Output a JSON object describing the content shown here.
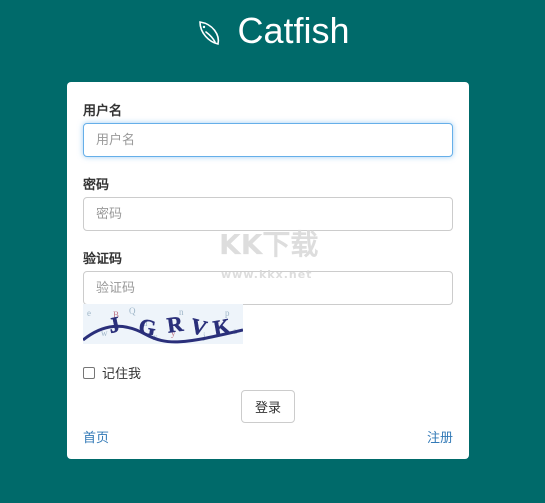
{
  "brand": {
    "name": "Catfish",
    "icon": "fish-icon"
  },
  "form": {
    "username_label": "用户名",
    "username_placeholder": "用户名",
    "password_label": "密码",
    "password_placeholder": "密码",
    "captcha_label": "验证码",
    "captcha_placeholder": "验证码",
    "captcha_text": "JGRVK",
    "remember_label": "记住我",
    "remember_checked": false,
    "login_button": "登录",
    "home_link": "首页",
    "register_link": "注册"
  },
  "watermark": {
    "title": "KK下载",
    "url": "www.kkx.net"
  },
  "colors": {
    "background": "#006a6a",
    "link": "#337ab7",
    "focus": "#66afe9"
  }
}
